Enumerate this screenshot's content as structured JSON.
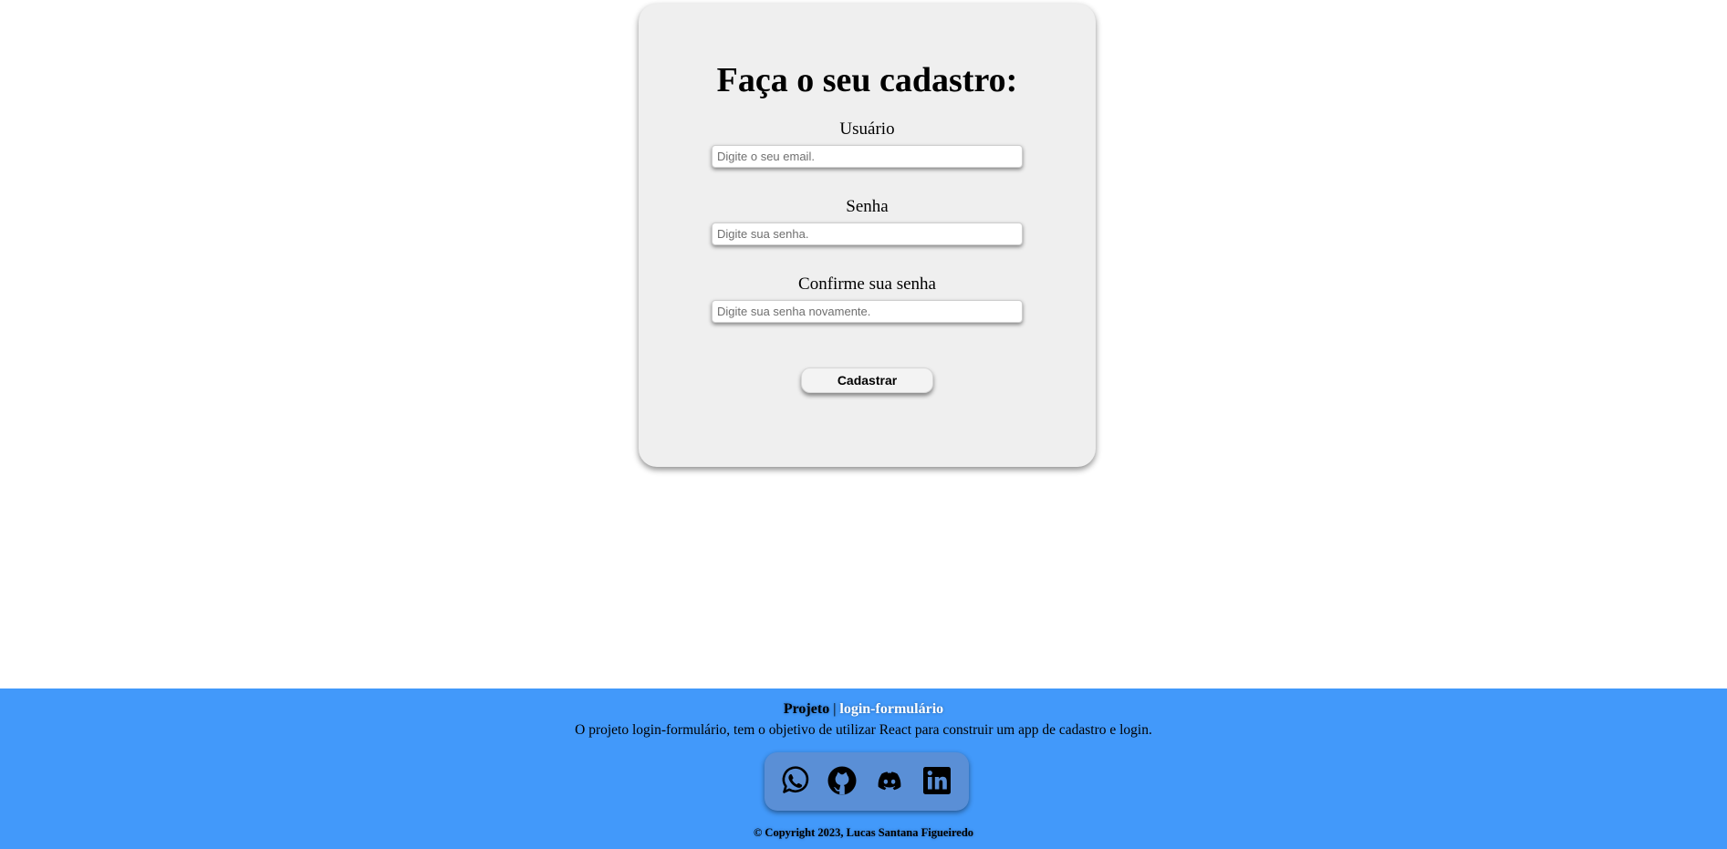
{
  "form": {
    "title": "Faça o seu cadastro:",
    "user_label": "Usuário",
    "user_placeholder": "Digite o seu email.",
    "password_label": "Senha",
    "password_placeholder": "Digite sua senha.",
    "confirm_label": "Confirme sua senha",
    "confirm_placeholder": "Digite sua senha novamente.",
    "submit_label": "Cadastrar"
  },
  "footer": {
    "project_label": "Projeto",
    "separator": "|",
    "repo_link": "login-formulário",
    "description": "O projeto login-formulário, tem o objetivo de utilizar React para construir um app de cadastro e login.",
    "social_icons": [
      "whatsapp-icon",
      "github-icon",
      "discord-icon",
      "linkedin-icon"
    ],
    "copyright": "© Copyright 2023, Lucas Santana Figueiredo"
  },
  "colors": {
    "footer_background": "#4299fa",
    "card_background": "#efefef",
    "social_box": "#5a8fd6"
  }
}
